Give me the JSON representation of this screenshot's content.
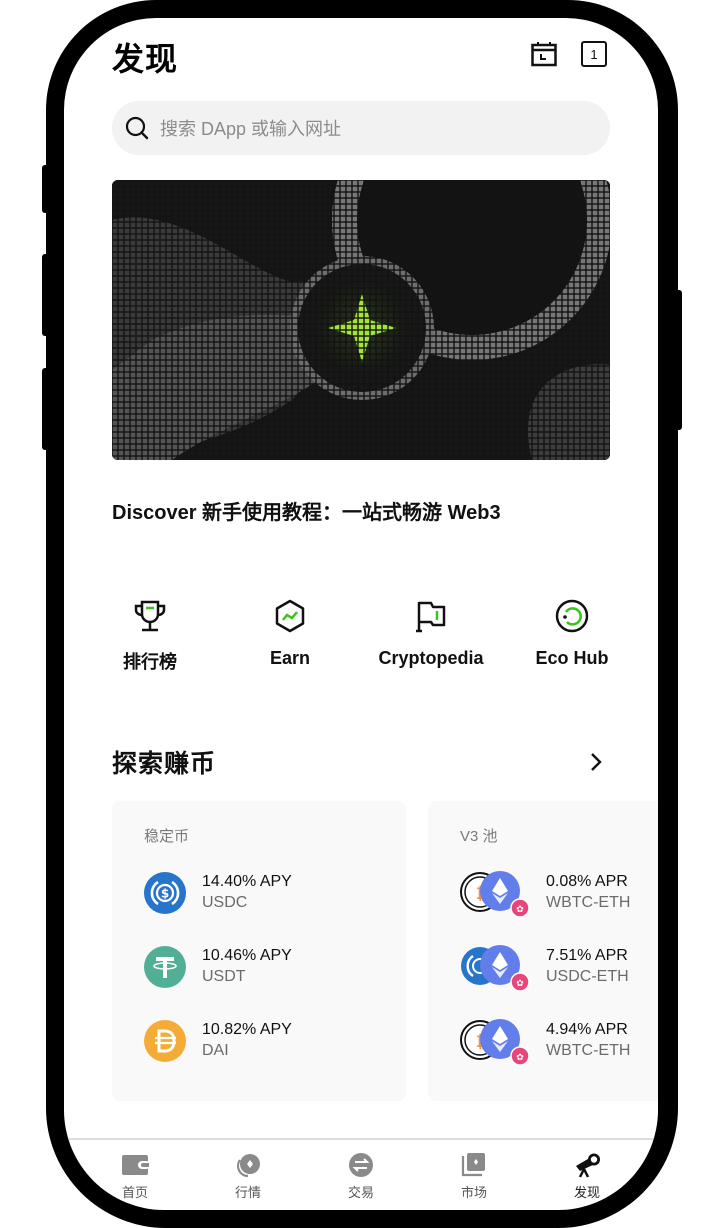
{
  "header": {
    "title": "发现",
    "calendar_icon": "calendar-icon",
    "tab_count": "1"
  },
  "search": {
    "placeholder": "搜索 DApp 或输入网址",
    "icon": "search-icon"
  },
  "banner": {
    "caption": "Discover 新手使用教程：一站式畅游 Web3",
    "accent": "#a3e635"
  },
  "quick_actions": [
    {
      "label": "排行榜",
      "icon": "trophy-icon"
    },
    {
      "label": "Earn",
      "icon": "hexagon-chart-icon"
    },
    {
      "label": "Cryptopedia",
      "icon": "flag-icon"
    },
    {
      "label": "Eco Hub",
      "icon": "circle-refresh-icon"
    }
  ],
  "earn_section": {
    "title": "探索赚币",
    "more_icon": "chevron-right-icon",
    "cards": [
      {
        "title": "稳定币",
        "items": [
          {
            "rate": "14.40% APY",
            "name": "USDC",
            "color": "#2775ca"
          },
          {
            "rate": "10.46% APY",
            "name": "USDT",
            "color": "#50af95"
          },
          {
            "rate": "10.82% APY",
            "name": "DAI",
            "color": "#f5ac37"
          }
        ]
      },
      {
        "title": "V3 池",
        "items": [
          {
            "rate": "0.08% APR",
            "name": "WBTC-ETH"
          },
          {
            "rate": "7.51% APR",
            "name": "USDC-ETH"
          },
          {
            "rate": "4.94% APR",
            "name": "WBTC-ETH"
          }
        ]
      }
    ]
  },
  "colors": {
    "eth": "#627eea",
    "uniswap": "#e8457a",
    "btc": "#f09242",
    "accent_green": "#3ac41e"
  },
  "tabbar": {
    "items": [
      {
        "label": "首页",
        "icon": "wallet-icon",
        "active": false
      },
      {
        "label": "行情",
        "icon": "coins-icon",
        "active": false
      },
      {
        "label": "交易",
        "icon": "swap-icon",
        "active": false
      },
      {
        "label": "市场",
        "icon": "marketplace-icon",
        "active": false
      },
      {
        "label": "发现",
        "icon": "telescope-icon",
        "active": true
      }
    ]
  }
}
